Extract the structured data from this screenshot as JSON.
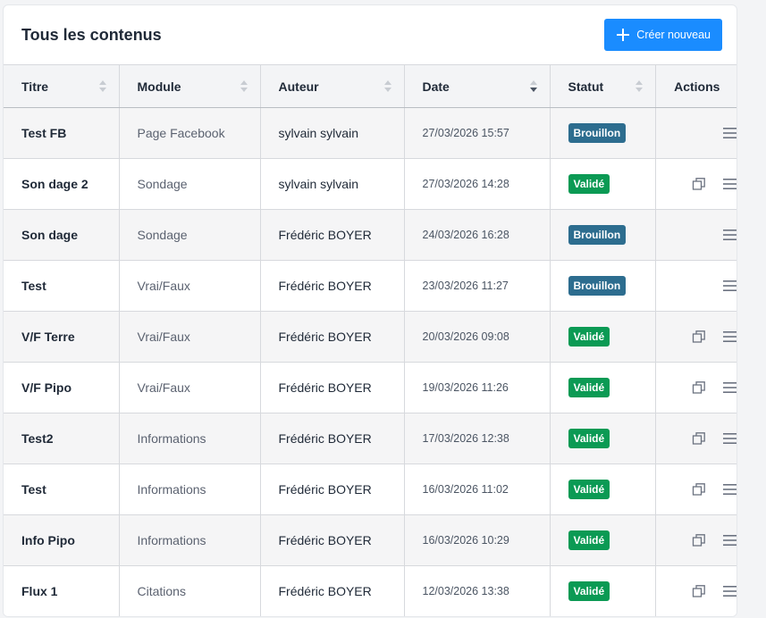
{
  "header": {
    "title": "Tous les contenus",
    "create_label": "Créer nouveau"
  },
  "columns": {
    "titre": "Titre",
    "module": "Module",
    "auteur": "Auteur",
    "date": "Date",
    "statut": "Statut",
    "actions": "Actions"
  },
  "colors": {
    "primary": "#1a8cff",
    "draft": "#2d6d8f",
    "valid": "#0b9a54"
  },
  "rows": [
    {
      "titre": "Test FB",
      "module": "Page Facebook",
      "auteur": "sylvain sylvain",
      "date": "27/03/2026 15:57",
      "statut": "Brouillon",
      "copy": false
    },
    {
      "titre": "Son dage 2",
      "module": "Sondage",
      "auteur": "sylvain sylvain",
      "date": "27/03/2026 14:28",
      "statut": "Validé",
      "copy": true
    },
    {
      "titre": "Son dage",
      "module": "Sondage",
      "auteur": "Frédéric BOYER",
      "date": "24/03/2026 16:28",
      "statut": "Brouillon",
      "copy": false
    },
    {
      "titre": "Test",
      "module": "Vrai/Faux",
      "auteur": "Frédéric BOYER",
      "date": "23/03/2026 11:27",
      "statut": "Brouillon",
      "copy": false
    },
    {
      "titre": "V/F Terre",
      "module": "Vrai/Faux",
      "auteur": "Frédéric BOYER",
      "date": "20/03/2026 09:08",
      "statut": "Validé",
      "copy": true
    },
    {
      "titre": "V/F Pipo",
      "module": "Vrai/Faux",
      "auteur": "Frédéric BOYER",
      "date": "19/03/2026 11:26",
      "statut": "Validé",
      "copy": true
    },
    {
      "titre": "Test2",
      "module": "Informations",
      "auteur": "Frédéric BOYER",
      "date": "17/03/2026 12:38",
      "statut": "Validé",
      "copy": true
    },
    {
      "titre": "Test",
      "module": "Informations",
      "auteur": "Frédéric BOYER",
      "date": "16/03/2026 11:02",
      "statut": "Validé",
      "copy": true
    },
    {
      "titre": "Info Pipo",
      "module": "Informations",
      "auteur": "Frédéric BOYER",
      "date": "16/03/2026 10:29",
      "statut": "Validé",
      "copy": true
    },
    {
      "titre": "Flux 1",
      "module": "Citations",
      "auteur": "Frédéric BOYER",
      "date": "12/03/2026 13:38",
      "statut": "Validé",
      "copy": true
    }
  ]
}
